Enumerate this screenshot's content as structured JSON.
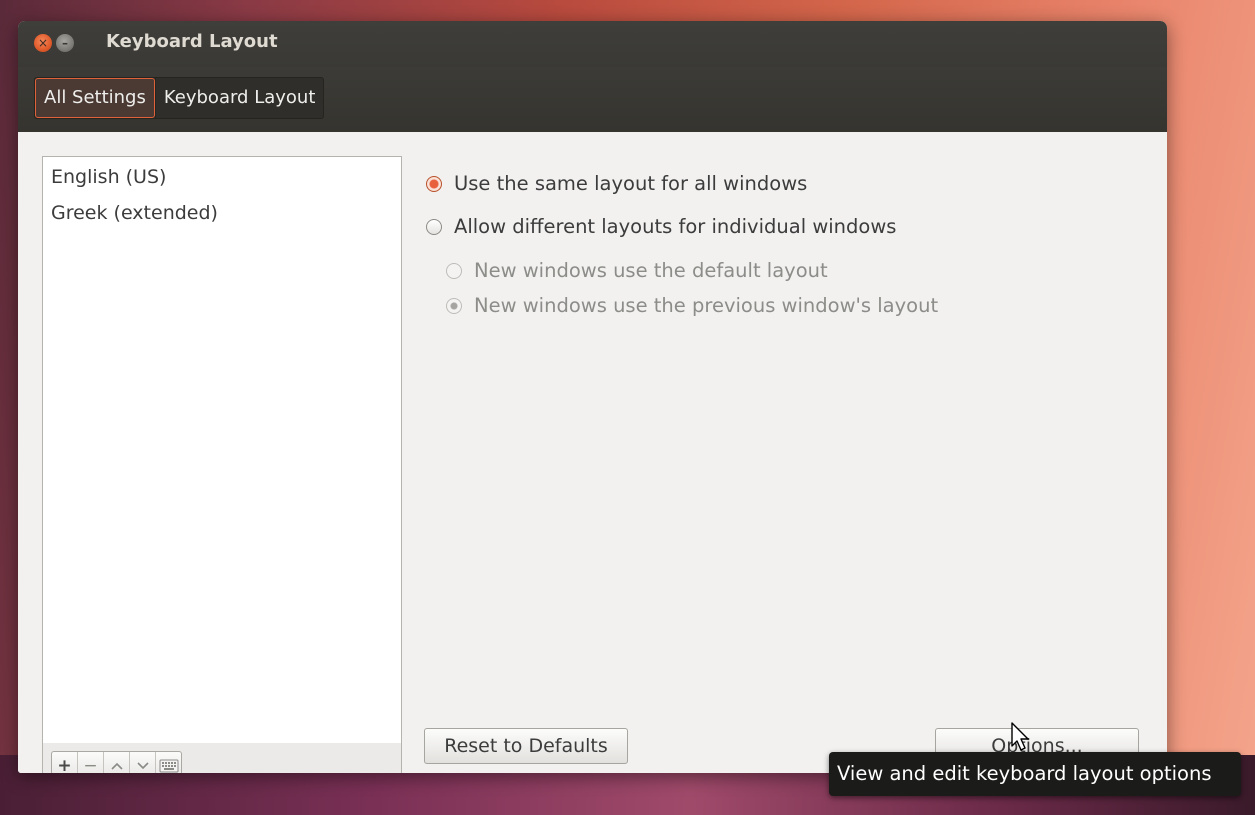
{
  "window": {
    "title": "Keyboard Layout",
    "close_glyph": "×",
    "minimize_glyph": "–"
  },
  "breadcrumbs": [
    {
      "label": "All Settings",
      "active": true
    },
    {
      "label": "Keyboard Layout",
      "active": false
    }
  ],
  "layouts": {
    "items": [
      "English (US)",
      "Greek (extended)"
    ],
    "toolbar": {
      "add": "+",
      "remove": "−",
      "move_up": "^",
      "move_down": "v",
      "keyboard_icon": "keyboard-icon"
    }
  },
  "options": {
    "same_layout": {
      "label": "Use the same layout for all windows",
      "checked": true
    },
    "different_layouts": {
      "label": "Allow different layouts for individual windows",
      "checked": false
    },
    "new_default": {
      "label": "New windows use the default layout",
      "checked": false,
      "enabled": false
    },
    "new_previous": {
      "label": "New windows use the previous window's layout",
      "checked": true,
      "enabled": false
    }
  },
  "buttons": {
    "reset": "Reset to Defaults",
    "options": "Options..."
  },
  "tooltip": "View and edit keyboard layout options",
  "colors": {
    "accent": "#e8613c",
    "titlebar": "#3c3b37",
    "tooltip_bg": "#1b1b19"
  }
}
